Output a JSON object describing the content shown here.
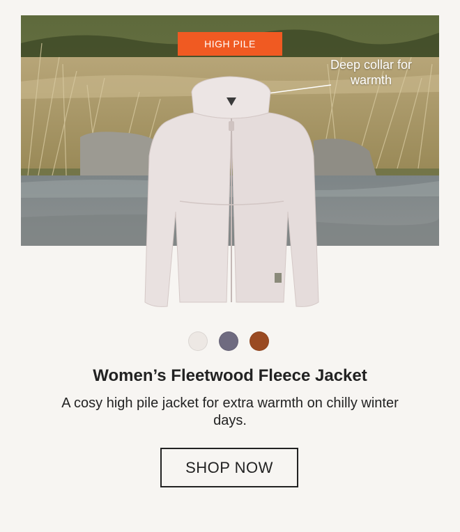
{
  "hero": {
    "badge_text": "HIGH PILE",
    "callout_text": "Deep collar for warmth",
    "badge_color": "#f05a22"
  },
  "product": {
    "color_swatches": [
      {
        "name": "cream",
        "color": "#ede8e4"
      },
      {
        "name": "slate-purple",
        "color": "#6f6b80"
      },
      {
        "name": "rust-brown",
        "color": "#9a4a22"
      }
    ],
    "title": "Women’s Fleetwood Fleece Jacket",
    "description": "A cosy high pile jacket for extra warmth on chilly winter days.",
    "cta_label": "SHOP NOW"
  }
}
